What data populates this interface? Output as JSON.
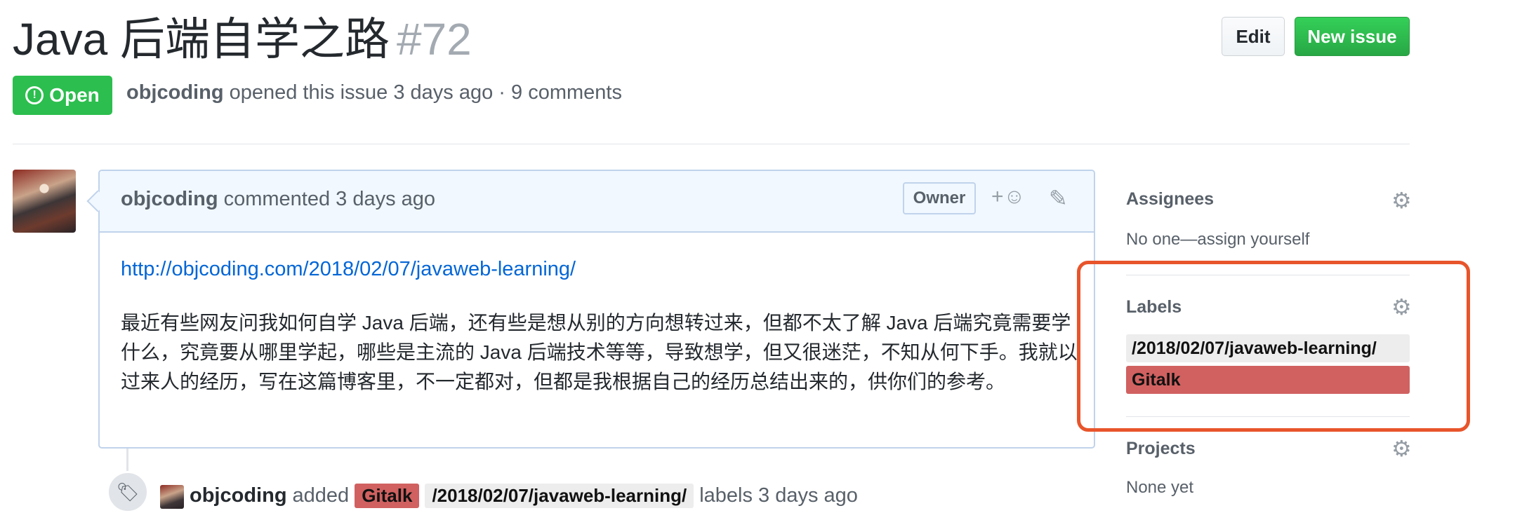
{
  "issue": {
    "title": "Java 后端自学之路",
    "number": "#72",
    "state_label": "Open",
    "author": "objcoding",
    "meta_rest": "opened this issue 3 days ago · 9 comments"
  },
  "header": {
    "edit_label": "Edit",
    "new_issue_label": "New issue"
  },
  "comment": {
    "author": "objcoding",
    "action": "commented 3 days ago",
    "owner_badge": "Owner",
    "reaction_label": "+☺",
    "link": "http://objcoding.com/2018/02/07/javaweb-learning/",
    "body": "最近有些网友问我如何自学 Java 后端，还有些是想从别的方向想转过来，但都不太了解 Java 后端究竟需要学什么，究竟要从哪里学起，哪些是主流的 Java 后端技术等等，导致想学，但又很迷茫，不知从何下手。我就以过来人的经历，写在这篇博客里，不一定都对，但都是我根据自己的经历总结出来的，供你们的参考。"
  },
  "timeline": {
    "event": {
      "actor": "objcoding",
      "verb": "added",
      "labels": [
        "Gitalk",
        "/2018/02/07/javaweb-learning/"
      ],
      "suffix": "labels 3 days ago"
    }
  },
  "sidebar": {
    "assignees": {
      "heading": "Assignees",
      "value": "No one—assign yourself"
    },
    "labels": {
      "heading": "Labels",
      "items": [
        {
          "name": "/2018/02/07/javaweb-learning/",
          "color": "#ededed"
        },
        {
          "name": "Gitalk",
          "color": "#d06160"
        }
      ]
    },
    "projects": {
      "heading": "Projects",
      "value": "None yet"
    }
  },
  "colors": {
    "open_green": "#2cbe4e",
    "new_issue_green": "#28a745",
    "link_blue": "#0366d6",
    "highlight_orange": "#e8552b"
  }
}
